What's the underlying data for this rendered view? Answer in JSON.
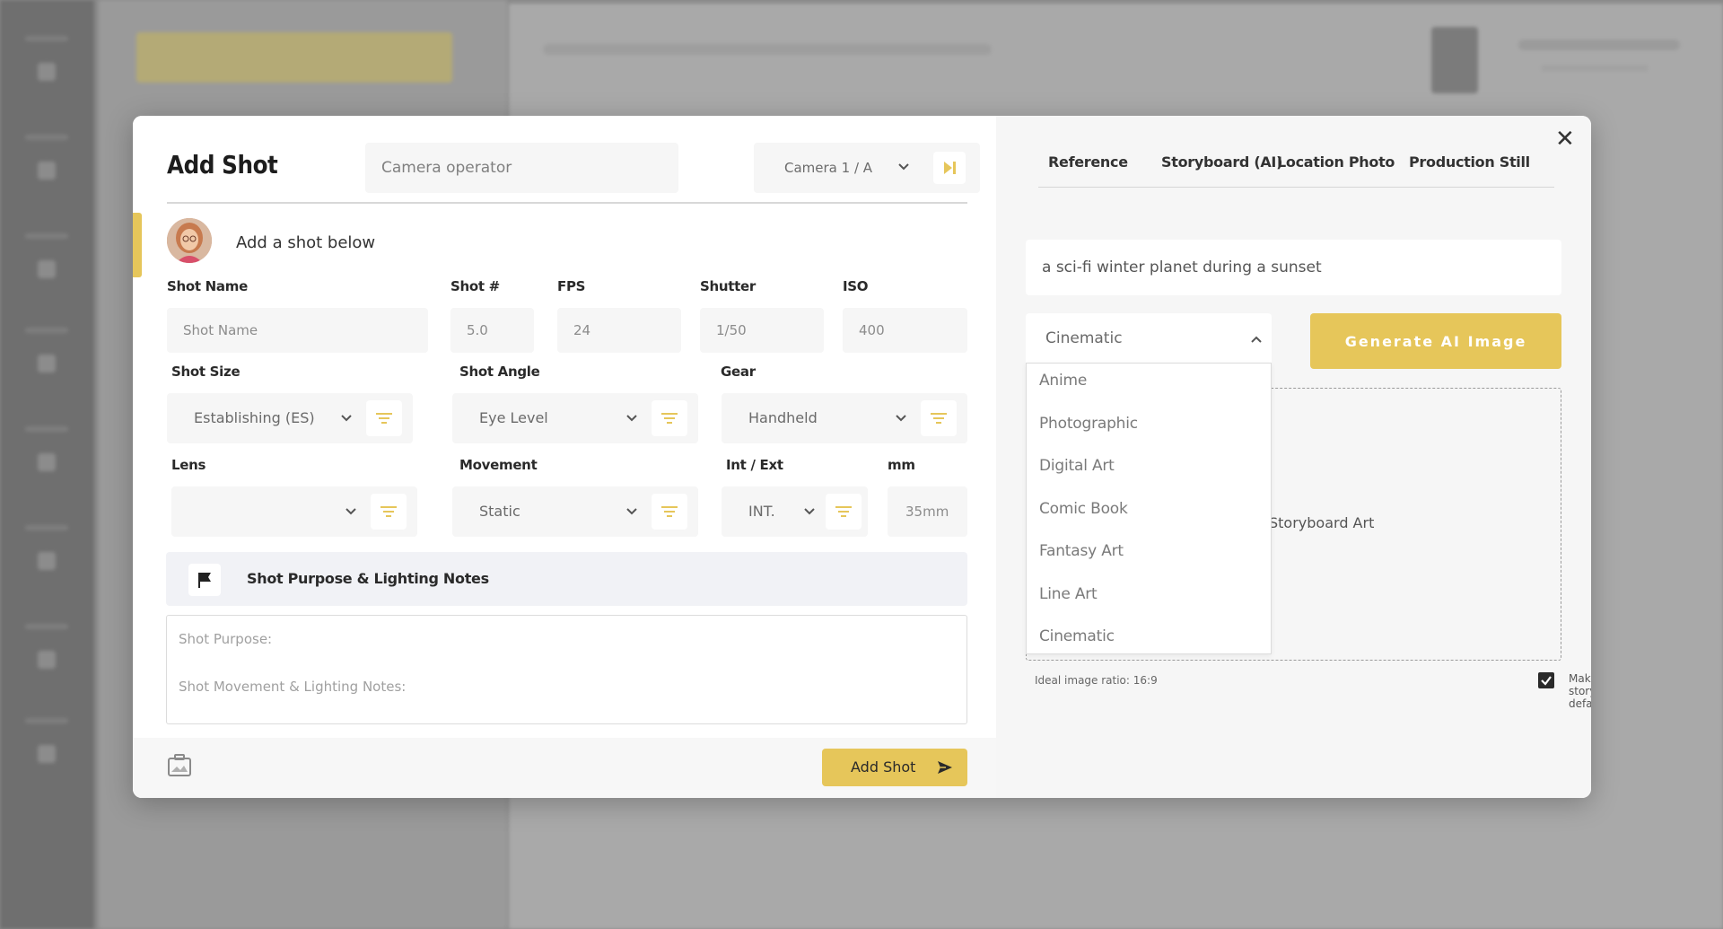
{
  "modal": {
    "title": "Add Shot",
    "camera_operator_placeholder": "Camera operator",
    "camera_value": "Camera 1 / A",
    "add_below_text": "Add a shot below",
    "fields": {
      "shot_name": {
        "label": "Shot Name",
        "placeholder": "Shot Name"
      },
      "shot_number": {
        "label": "Shot #",
        "value": "5.0"
      },
      "fps": {
        "label": "FPS",
        "value": "24"
      },
      "shutter": {
        "label": "Shutter",
        "value": "1/50"
      },
      "iso": {
        "label": "ISO",
        "value": "400"
      },
      "shot_size": {
        "label": "Shot Size",
        "value": "Establishing (ES)"
      },
      "shot_angle": {
        "label": "Shot Angle",
        "value": "Eye Level"
      },
      "gear": {
        "label": "Gear",
        "value": "Handheld"
      },
      "lens": {
        "label": "Lens",
        "value": ""
      },
      "movement": {
        "label": "Movement",
        "value": "Static"
      },
      "int_ext": {
        "label": "Int / Ext",
        "value": "INT."
      },
      "mm": {
        "label": "mm",
        "value": "35mm"
      }
    },
    "notes": {
      "header": "Shot Purpose & Lighting Notes",
      "purpose_placeholder": "Shot Purpose:",
      "movement_placeholder": "Shot Movement & Lighting Notes:"
    },
    "add_shot_button": "Add Shot"
  },
  "right_panel": {
    "tabs": [
      "Reference",
      "Storyboard (AI)",
      "Location Photo",
      "Production Still"
    ],
    "prompt": "a sci-fi winter planet during a sunset",
    "style_selected": "Cinematic",
    "style_options": [
      "Anime",
      "Photographic",
      "Digital Art",
      "Comic Book",
      "Fantasy Art",
      "Line Art",
      "Cinematic"
    ],
    "generate_button": "Generate AI Image",
    "drop_zone_text": "Storyboard Art",
    "ratio_note": "Ideal image ratio: 16:9",
    "make_default_label": "Make storyboard default",
    "make_default_checked": true
  },
  "colors": {
    "accent": "#e6c65a",
    "field_bg": "#f6f6f6",
    "notes_bar_bg": "#f1f2f6"
  }
}
